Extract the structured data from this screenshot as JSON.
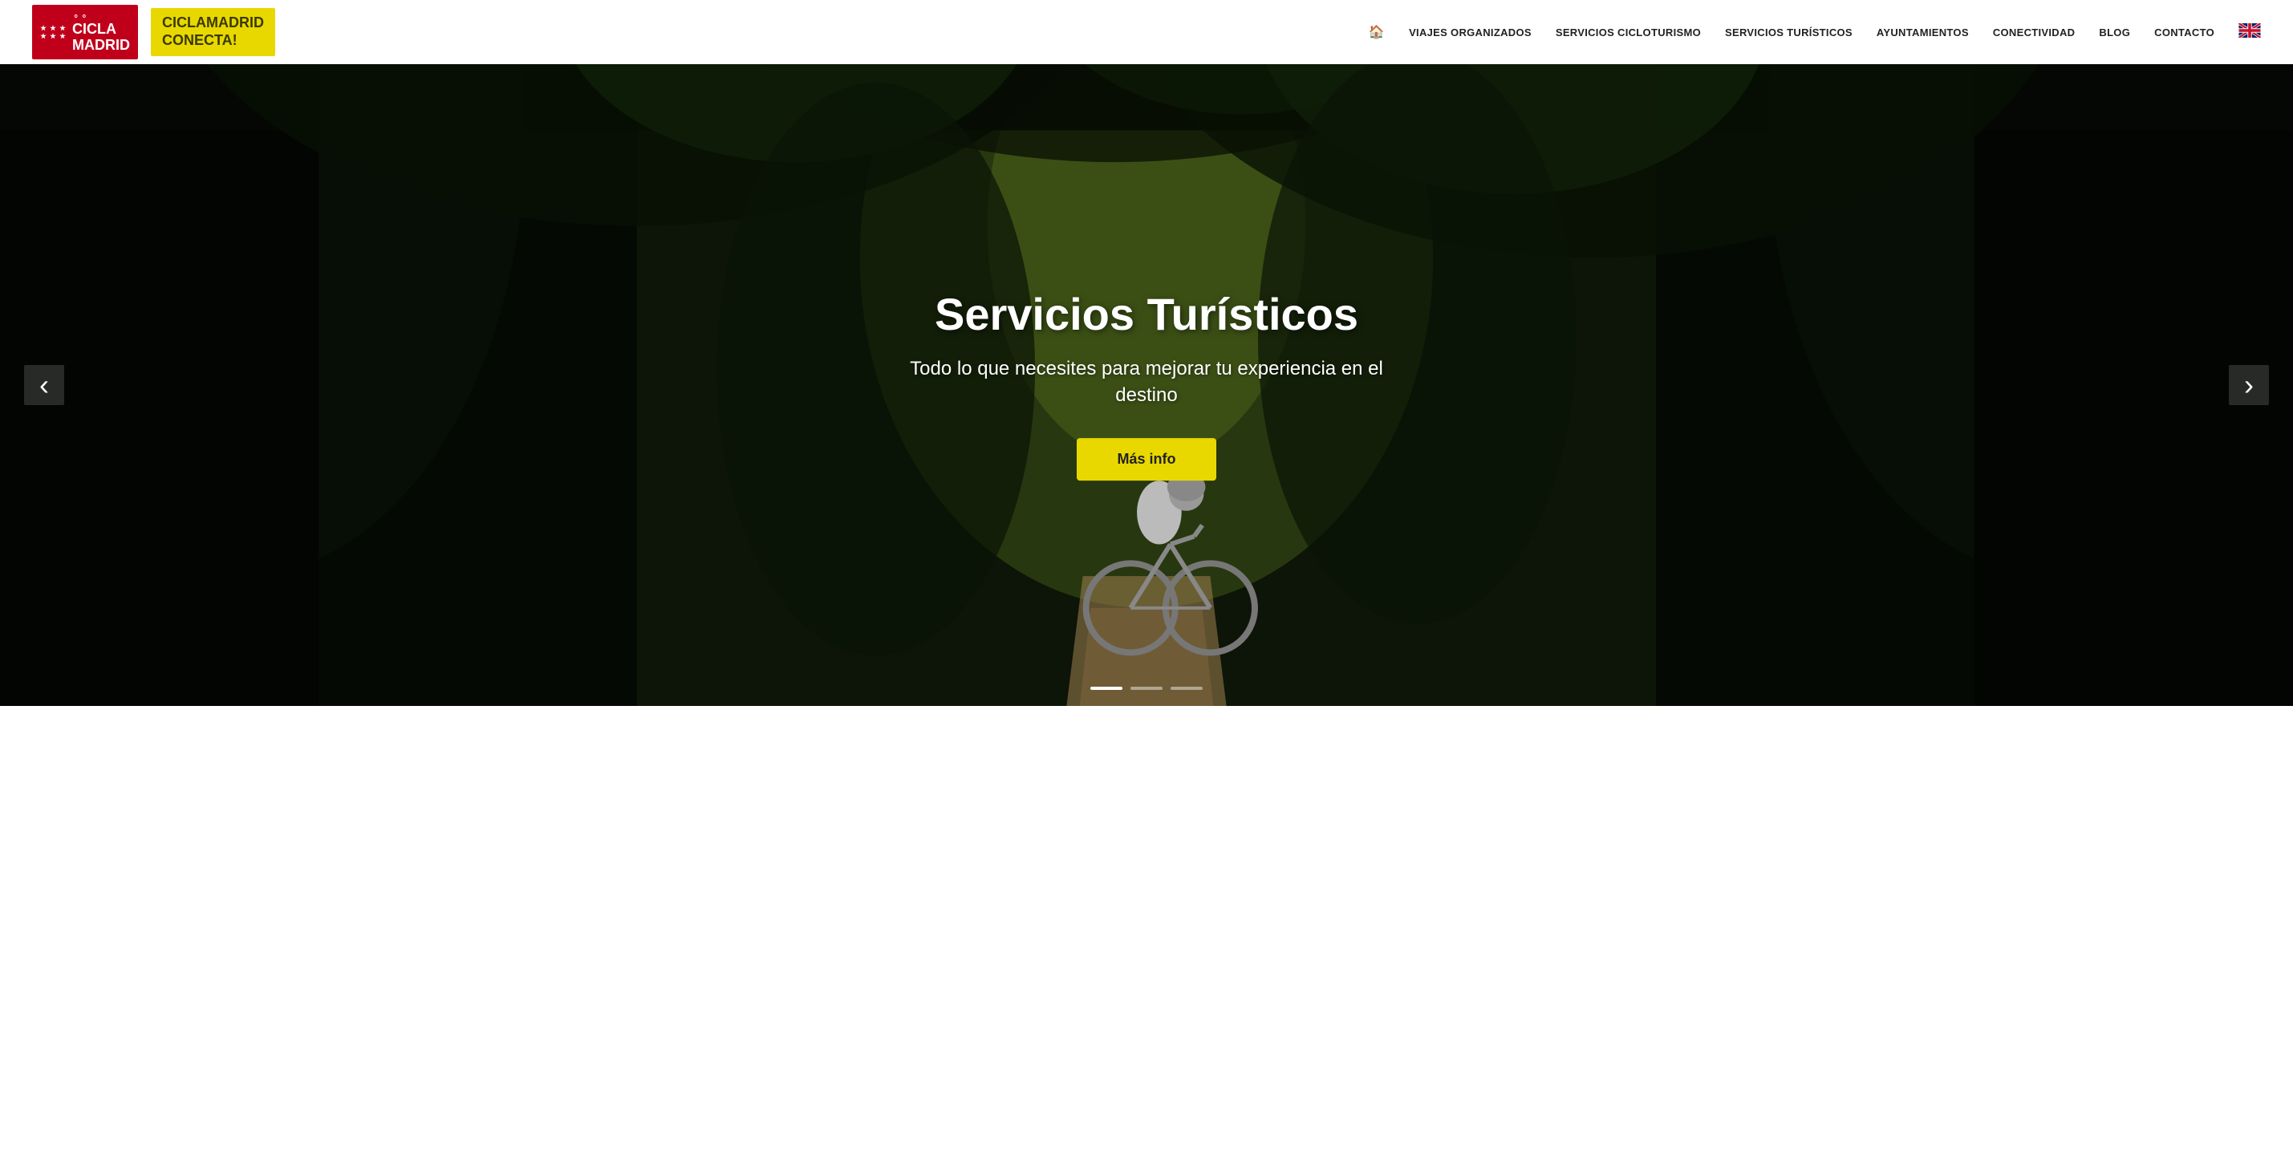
{
  "header": {
    "logo": {
      "ciclamadrid_line1": "CICLA",
      "ciclamadrid_line2": "MADRID",
      "conecta_line1": "CICLAMADRID",
      "conecta_line2": "CONECTA!"
    },
    "nav": {
      "home_icon": "🏠",
      "items": [
        {
          "id": "viajes",
          "label": "VIAJES ORGANIZADOS"
        },
        {
          "id": "servicios-ciclo",
          "label": "SERVICIOS CICLOTURISMO"
        },
        {
          "id": "servicios-turisticos",
          "label": "SERVICIOS TURÍSTICOS"
        },
        {
          "id": "ayuntamientos",
          "label": "AYUNTAMIENTOS"
        },
        {
          "id": "conectividad",
          "label": "CONECTIVIDAD"
        },
        {
          "id": "blog",
          "label": "BLOG"
        },
        {
          "id": "contacto",
          "label": "CONTACTO"
        }
      ],
      "lang": "EN"
    }
  },
  "hero": {
    "title": "Servicios Turísticos",
    "subtitle": "Todo lo que necesites para mejorar tu experiencia en el destino",
    "cta_label": "Más info",
    "arrow_prev": "‹",
    "arrow_next": "›",
    "dots": [
      {
        "id": 1,
        "active": true
      },
      {
        "id": 2,
        "active": false
      },
      {
        "id": 3,
        "active": false
      }
    ]
  },
  "colors": {
    "red": "#c0001b",
    "yellow": "#e8d800",
    "dark": "#0d1408",
    "white": "#ffffff",
    "nav_text": "#222222"
  }
}
